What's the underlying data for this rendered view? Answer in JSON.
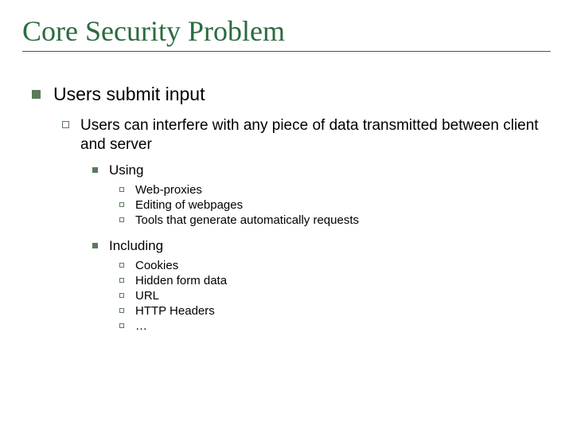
{
  "title": "Core Security Problem",
  "l1": "Users submit input",
  "l2": "Users can interfere with any piece of data transmitted between client and server",
  "l3a": "Using",
  "l3a_items": {
    "i1": "Web-proxies",
    "i2": "Editing of webpages",
    "i3": "Tools that generate automatically requests"
  },
  "l3b": "Including",
  "l3b_items": {
    "i1": "Cookies",
    "i2": "Hidden form data",
    "i3": "URL",
    "i4": "HTTP Headers",
    "i5": "…"
  }
}
